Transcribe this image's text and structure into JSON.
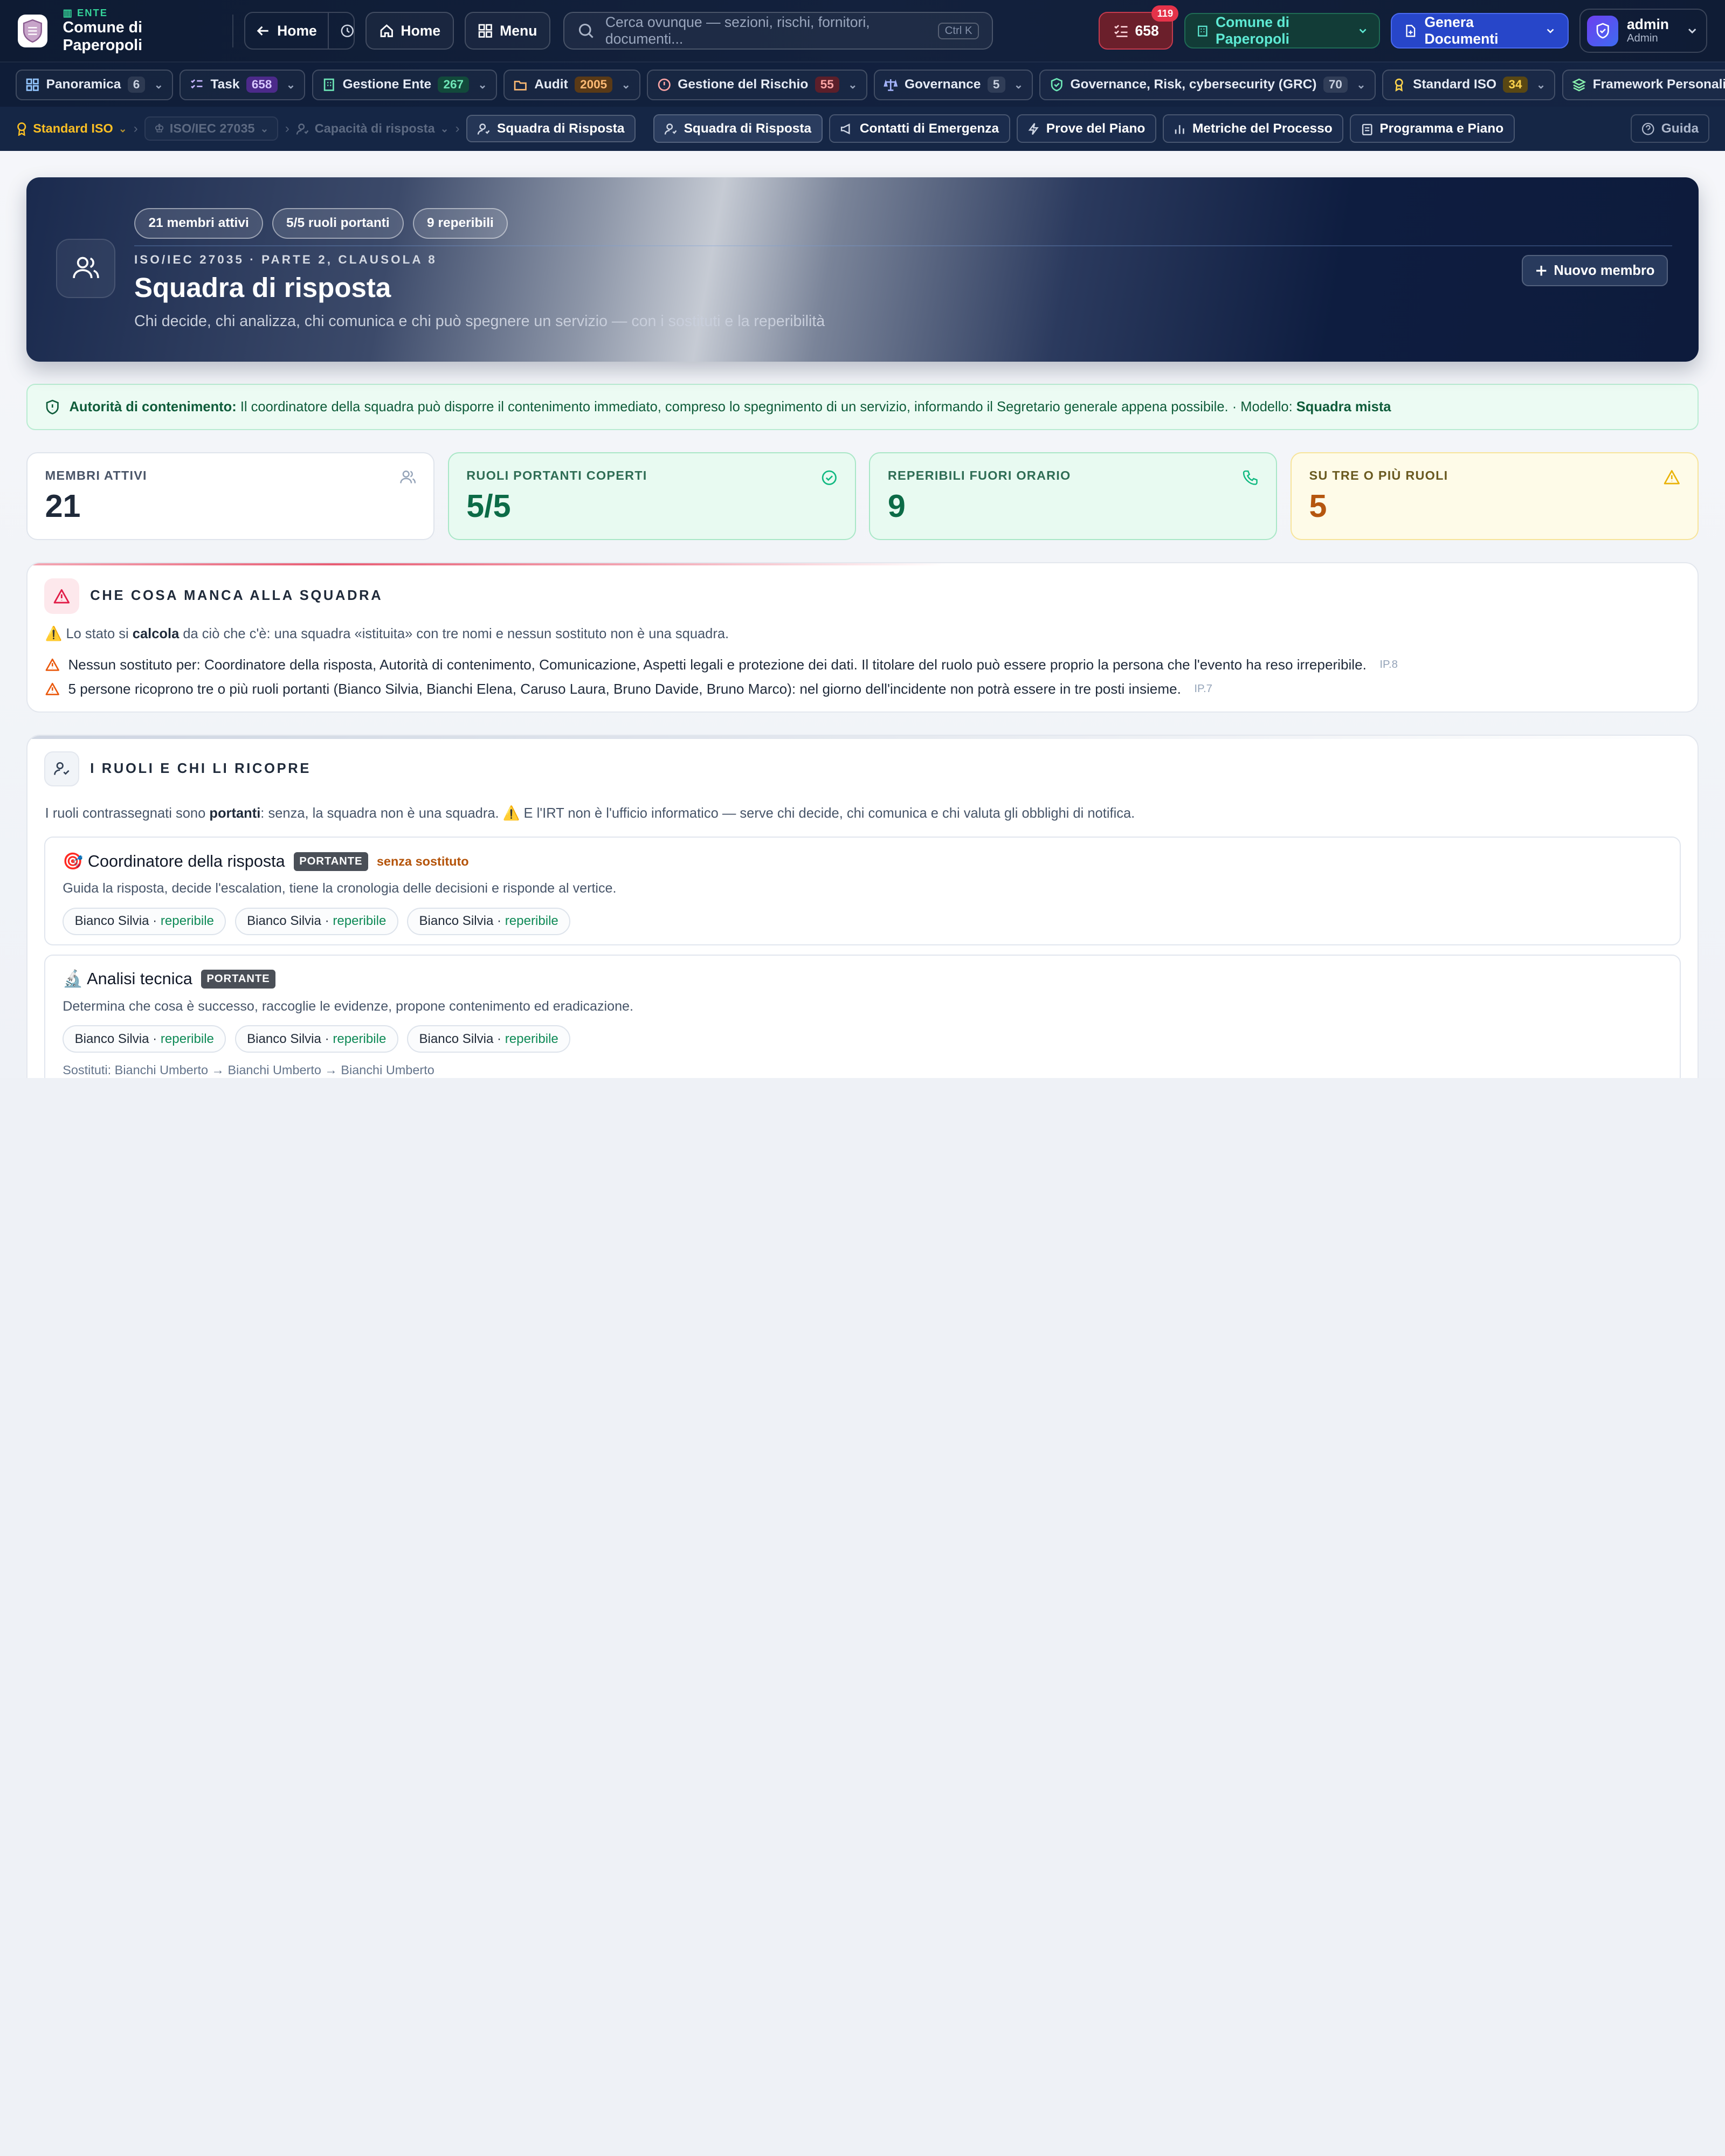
{
  "topbar": {
    "ente_label": "ENTE",
    "ente_name": "Comune di Paperopoli",
    "back_label": "Home",
    "home_label": "Home",
    "menu_label": "Menu",
    "search_placeholder": "Cerca ovunque — sezioni, rischi, fornitori, documenti...",
    "search_shortcut": "Ctrl K",
    "tasks_count": "658",
    "tasks_badge": "119",
    "ente_selector": "Comune di Paperopoli",
    "generate_label": "Genera Documenti",
    "user_name": "admin",
    "user_role": "Admin"
  },
  "nav": [
    {
      "label": "Panoramica",
      "count": "6",
      "color": "#93c5fd",
      "count_bg": "rgba(255,255,255,.1)",
      "count_color": "#c9d1e0"
    },
    {
      "label": "Task",
      "count": "658",
      "color": "#c4b5fd",
      "count_bg": "#4c2a8a",
      "count_color": "#d8c8ff"
    },
    {
      "label": "Gestione Ente",
      "count": "267",
      "color": "#6ee7b7",
      "count_bg": "#124a3b",
      "count_color": "#6ee7b7"
    },
    {
      "label": "Audit",
      "count": "2005",
      "color": "#fdba74",
      "count_bg": "#5a3a17",
      "count_color": "#fdba74"
    },
    {
      "label": "Gestione del Rischio",
      "count": "55",
      "color": "#fca5a5",
      "count_bg": "#5c1f2a",
      "count_color": "#fca5a5"
    },
    {
      "label": "Governance",
      "count": "5",
      "color": "#a5b4fc",
      "count_bg": "rgba(255,255,255,.1)",
      "count_color": "#c9d1e0"
    },
    {
      "label": "Governance, Risk, cybersecurity (GRC)",
      "count": "70",
      "color": "#6ee7b7",
      "count_bg": "rgba(255,255,255,.1)",
      "count_color": "#c9d1e0"
    },
    {
      "label": "Standard ISO",
      "count": "34",
      "color": "#fcd34d",
      "count_bg": "#594713",
      "count_color": "#fcd34d"
    },
    {
      "label": "Framework Personalizzati",
      "count": "",
      "color": "#86efac",
      "count_bg": "",
      "count_color": ""
    }
  ],
  "breadcrumb": {
    "standard": "Standard ISO",
    "iso": "ISO/IEC 27035",
    "capacity": "Capacità di risposta",
    "current": "Squadra di Risposta"
  },
  "subnav": [
    "Squadra di Risposta",
    "Contatti di Emergenza",
    "Prove del Piano",
    "Metriche del Processo",
    "Programma e Piano"
  ],
  "guide_label": "Guida",
  "hero": {
    "pills": [
      "21 membri attivi",
      "5/5 ruoli portanti",
      "9 reperibili"
    ],
    "kicker": "ISO/IEC 27035 · PARTE 2, CLAUSOLA 8",
    "title": "Squadra di risposta",
    "subtitle": "Chi decide, chi analizza, chi comunica e chi può spegnere un servizio — con i sostituti e la reperibilità",
    "new_label": "Nuovo membro"
  },
  "authority": {
    "label": "Autorità di contenimento:",
    "text": "Il coordinatore della squadra può disporre il contenimento immediato, compreso lo spegnimento di un servizio, informando il Segretario generale appena possibile. · Modello:",
    "model": "Squadra mista"
  },
  "kpis": [
    {
      "label": "MEMBRI ATTIVI",
      "value": "21",
      "icon": "users-icon",
      "color": "#94a3b8"
    },
    {
      "label": "RUOLI PORTANTI COPERTI",
      "value": "5/5",
      "icon": "check-circle-icon",
      "color": "#10b981"
    },
    {
      "label": "REPERIBILI FUORI ORARIO",
      "value": "9",
      "icon": "phone-icon",
      "color": "#10b981"
    },
    {
      "label": "SU TRE O PIÙ RUOLI",
      "value": "5",
      "icon": "warning-icon",
      "color": "#eab308"
    }
  ],
  "gaps": {
    "title": "CHE COSA MANCA ALLA SQUADRA",
    "intro_pre": "⚠️ Lo stato si",
    "intro_bold": "calcola",
    "intro_post": "da ciò che c'è: una squadra «istituita» con tre nomi e nessun sostituto non è una squadra.",
    "items": [
      {
        "text": "Nessun sostituto per: Coordinatore della risposta, Autorità di contenimento, Comunicazione, Aspetti legali e protezione dei dati. Il titolare del ruolo può essere proprio la persona che l'evento ha reso irreperibile.",
        "ref": "IP.8"
      },
      {
        "text": "5 persone ricoprono tre o più ruoli portanti (Bianco Silvia, Bianchi Elena, Caruso Laura, Bruno Davide, Bruno Marco): nel giorno dell'incidente non potrà essere in tre posti insieme.",
        "ref": "IP.7"
      }
    ]
  },
  "roles_section": {
    "title": "I RUOLI E CHI LI RICOPRE",
    "intro_pre": "I ruoli contrassegnati sono",
    "intro_bold": "portanti",
    "intro_post": ": senza, la squadra non è una squadra. ⚠️ E l'IRT non è l'ufficio informatico — serve chi decide, chi comunica e chi valuta gli obblighi di notifica.",
    "roles": [
      {
        "emoji": "🎯",
        "name": "Coordinatore della risposta",
        "tag": "PORTANTE",
        "warning": "senza sostituto",
        "desc": "Guida la risposta, decide l'escalation, tiene la cronologia delle decisioni e risponde al vertice.",
        "members": [
          "Bianco Silvia",
          "Bianco Silvia",
          "Bianco Silvia"
        ],
        "status": "reperibile",
        "subs": ""
      },
      {
        "emoji": "🔬",
        "name": "Analisi tecnica",
        "tag": "PORTANTE",
        "warning": "",
        "desc": "Determina che cosa è successo, raccoglie le evidenze, propone contenimento ed eradicazione.",
        "members": [
          "Bianco Silvia",
          "Bianco Silvia",
          "Bianco Silvia"
        ],
        "status": "reperibile",
        "subs": "Sostituti: Bianchi Umberto → Bianchi Umberto → Bianchi Umberto"
      }
    ]
  }
}
